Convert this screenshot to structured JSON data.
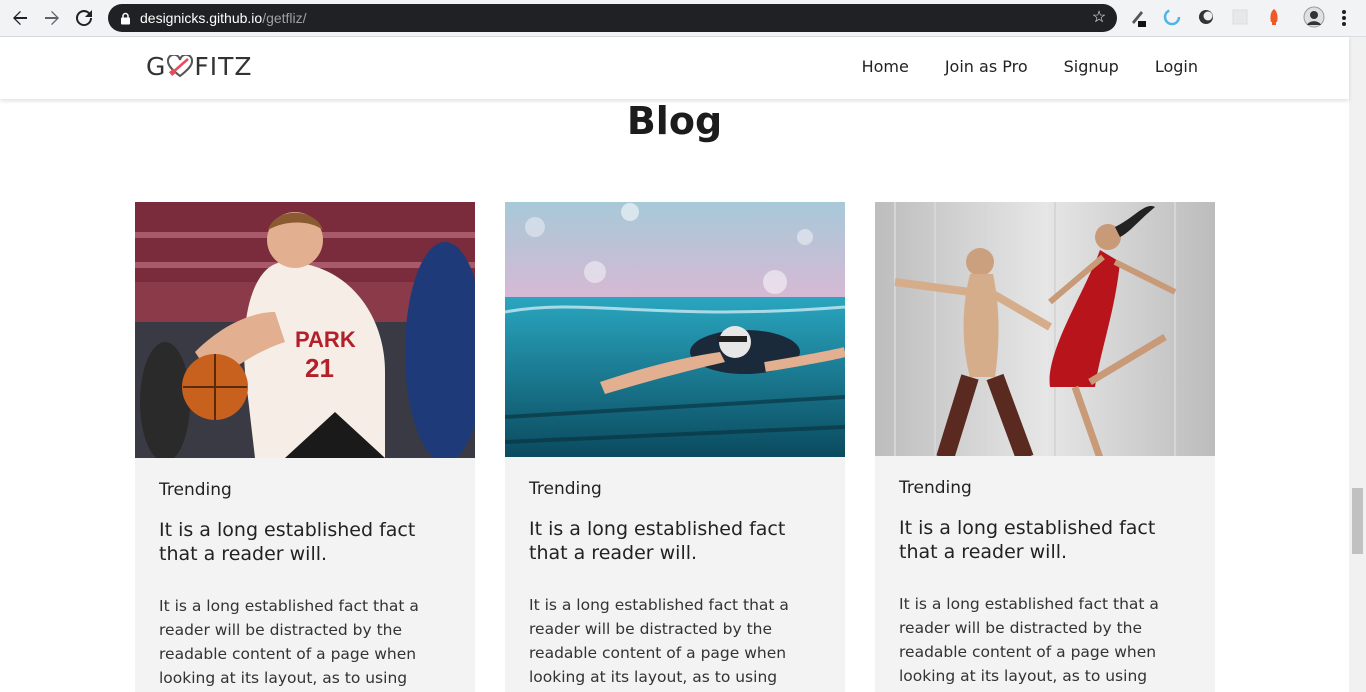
{
  "browser": {
    "url_host": "designicks.github.io",
    "url_path": "/getfliz/"
  },
  "site": {
    "logo_left": "G",
    "logo_right": "FITZ",
    "nav": [
      {
        "label": "Home"
      },
      {
        "label": "Join as Pro"
      },
      {
        "label": "Signup"
      },
      {
        "label": "Login"
      }
    ]
  },
  "blog": {
    "title": "Blog",
    "posts": [
      {
        "category": "Trending",
        "title": "It is a long established fact that a reader will.",
        "excerpt": "It is a long established fact that a reader will be distracted by the readable content of a page when looking at its layout, as to using",
        "image": "basketball-player-photo"
      },
      {
        "category": "Trending",
        "title": "It is a long established fact that a reader will.",
        "excerpt": "It is a long established fact that a reader will be distracted by the readable content of a page when looking at its layout, as to using",
        "image": "swimmer-photo"
      },
      {
        "category": "Trending",
        "title": "It is a long established fact that a reader will.",
        "excerpt": "It is a long established fact that a reader will be distracted by the readable content of a page when looking at its layout, as to using",
        "image": "dancers-photo"
      }
    ]
  },
  "colors": {
    "brand_heart": "#e94b5b",
    "omnibox_bg": "#202124",
    "card_bg": "#f3f3f3"
  }
}
